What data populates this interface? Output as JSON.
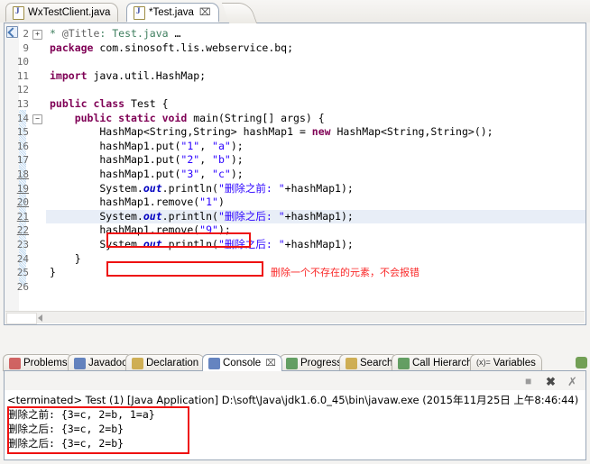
{
  "editor": {
    "tabs": [
      {
        "label": "WxTestClient.java",
        "icon": "java-file-icon",
        "active": false,
        "dirty": false,
        "closeable": false
      },
      {
        "label": "*Test.java",
        "icon": "java-file-icon",
        "active": true,
        "dirty": true,
        "closeable": true,
        "close_glyph": "⌧"
      }
    ],
    "lines": [
      {
        "num": "2",
        "fold": "plus",
        "marker": "javadoc",
        "underline": false,
        "highlight": false,
        "segments": [
          {
            "t": "* ",
            "c": "cmt"
          },
          {
            "t": "@Title",
            "c": "ann"
          },
          {
            "t": ": Test.java ",
            "c": "cmt"
          },
          {
            "t": "…",
            "c": "boxchar"
          }
        ]
      },
      {
        "num": "9",
        "fold": "",
        "marker": "",
        "underline": false,
        "highlight": false,
        "segments": [
          {
            "t": "package ",
            "c": "kw"
          },
          {
            "t": "com.sinosoft.lis.webservice.bq;",
            "c": "pl"
          }
        ]
      },
      {
        "num": "10",
        "fold": "",
        "marker": "",
        "underline": false,
        "highlight": false,
        "segments": [
          {
            "t": "",
            "c": "pl"
          }
        ]
      },
      {
        "num": "11",
        "fold": "",
        "marker": "",
        "underline": false,
        "highlight": false,
        "segments": [
          {
            "t": "import ",
            "c": "kw"
          },
          {
            "t": "java.util.HashMap;",
            "c": "pl"
          }
        ]
      },
      {
        "num": "12",
        "fold": "",
        "marker": "",
        "underline": false,
        "highlight": false,
        "segments": [
          {
            "t": "",
            "c": "pl"
          }
        ]
      },
      {
        "num": "13",
        "fold": "",
        "marker": "",
        "underline": false,
        "highlight": false,
        "segments": [
          {
            "t": "public class ",
            "c": "kw"
          },
          {
            "t": "Test {",
            "c": "pl"
          }
        ]
      },
      {
        "num": "14",
        "fold": "minus",
        "marker": "",
        "underline": false,
        "highlight": false,
        "segments": [
          {
            "t": "    public static void ",
            "c": "kw"
          },
          {
            "t": "main(String[] args) {",
            "c": "pl"
          }
        ]
      },
      {
        "num": "15",
        "fold": "",
        "marker": "",
        "underline": false,
        "highlight": false,
        "segments": [
          {
            "t": "        HashMap<String,String> hashMap1 = ",
            "c": "pl"
          },
          {
            "t": "new ",
            "c": "kw"
          },
          {
            "t": "HashMap<String,String>();",
            "c": "pl"
          }
        ]
      },
      {
        "num": "16",
        "fold": "",
        "marker": "",
        "underline": false,
        "highlight": false,
        "segments": [
          {
            "t": "        hashMap1.put(",
            "c": "pl"
          },
          {
            "t": "\"1\"",
            "c": "str"
          },
          {
            "t": ", ",
            "c": "pl"
          },
          {
            "t": "\"a\"",
            "c": "str"
          },
          {
            "t": ");",
            "c": "pl"
          }
        ]
      },
      {
        "num": "17",
        "fold": "",
        "marker": "",
        "underline": false,
        "highlight": false,
        "segments": [
          {
            "t": "        hashMap1.put(",
            "c": "pl"
          },
          {
            "t": "\"2\"",
            "c": "str"
          },
          {
            "t": ", ",
            "c": "pl"
          },
          {
            "t": "\"b\"",
            "c": "str"
          },
          {
            "t": ");",
            "c": "pl"
          }
        ]
      },
      {
        "num": "18",
        "fold": "",
        "marker": "",
        "underline": true,
        "highlight": false,
        "segments": [
          {
            "t": "        hashMap1.put(",
            "c": "pl"
          },
          {
            "t": "\"3\"",
            "c": "str"
          },
          {
            "t": ", ",
            "c": "pl"
          },
          {
            "t": "\"c\"",
            "c": "str"
          },
          {
            "t": ");",
            "c": "pl"
          }
        ]
      },
      {
        "num": "19",
        "fold": "",
        "marker": "",
        "underline": true,
        "highlight": false,
        "segments": [
          {
            "t": "        System.",
            "c": "pl"
          },
          {
            "t": "out",
            "c": "fld"
          },
          {
            "t": ".println(",
            "c": "pl"
          },
          {
            "t": "\"删除之前: \"",
            "c": "str"
          },
          {
            "t": "+hashMap1);",
            "c": "pl"
          }
        ]
      },
      {
        "num": "20",
        "fold": "",
        "marker": "",
        "underline": true,
        "highlight": false,
        "segments": [
          {
            "t": "        hashMap1.remove(",
            "c": "pl"
          },
          {
            "t": "\"1\"",
            "c": "str"
          },
          {
            "t": ")",
            "c": "pl"
          }
        ]
      },
      {
        "num": "21",
        "fold": "",
        "marker": "",
        "underline": true,
        "highlight": true,
        "segments": [
          {
            "t": "        System.",
            "c": "pl"
          },
          {
            "t": "out",
            "c": "fld"
          },
          {
            "t": ".println(",
            "c": "pl"
          },
          {
            "t": "\"删除之后: \"",
            "c": "str"
          },
          {
            "t": "+hashMap1);",
            "c": "pl"
          }
        ]
      },
      {
        "num": "22",
        "fold": "",
        "marker": "",
        "underline": true,
        "highlight": false,
        "segments": [
          {
            "t": "        hashMap1.remove(",
            "c": "pl"
          },
          {
            "t": "\"9\"",
            "c": "str"
          },
          {
            "t": ");",
            "c": "pl"
          }
        ]
      },
      {
        "num": "23",
        "fold": "",
        "marker": "",
        "underline": false,
        "highlight": false,
        "segments": [
          {
            "t": "        System.",
            "c": "pl"
          },
          {
            "t": "out",
            "c": "fld"
          },
          {
            "t": ".println(",
            "c": "pl"
          },
          {
            "t": "\"删除之后: \"",
            "c": "str"
          },
          {
            "t": "+hashMap1);",
            "c": "pl"
          }
        ]
      },
      {
        "num": "24",
        "fold": "",
        "marker": "",
        "underline": false,
        "highlight": false,
        "segments": [
          {
            "t": "    }",
            "c": "pl"
          }
        ]
      },
      {
        "num": "25",
        "fold": "",
        "marker": "",
        "underline": false,
        "highlight": false,
        "segments": [
          {
            "t": "}",
            "c": "pl"
          }
        ]
      },
      {
        "num": "26",
        "fold": "",
        "marker": "",
        "underline": false,
        "highlight": false,
        "segments": [
          {
            "t": "",
            "c": "pl"
          }
        ]
      }
    ],
    "annotation_note": "删除一个不存在的元素，不会报错",
    "annotation_color": "#fa2a2a"
  },
  "views": {
    "tabs": [
      {
        "label": "Problems",
        "icon": "problems-icon",
        "active": false
      },
      {
        "label": "Javadoc",
        "icon": "javadoc-icon",
        "active": false
      },
      {
        "label": "Declaration",
        "icon": "declaration-icon",
        "active": false
      },
      {
        "label": "Console",
        "icon": "console-icon",
        "active": true,
        "close_glyph": "⌧"
      },
      {
        "label": "Progress",
        "icon": "progress-icon",
        "active": false
      },
      {
        "label": "Search",
        "icon": "search-icon",
        "active": false
      },
      {
        "label": "Call Hierarchy",
        "icon": "call-hierarchy-icon",
        "active": false
      },
      {
        "label": "Variables",
        "icon": "variables-icon",
        "active": false,
        "prefix": "(x)="
      }
    ]
  },
  "console": {
    "toolbar": [
      {
        "name": "terminate-button",
        "glyph": "■"
      },
      {
        "name": "remove-launch-button",
        "glyph": "✖"
      },
      {
        "name": "remove-all-terminated-button",
        "glyph": "✗"
      }
    ],
    "launch_line": "<terminated> Test (1) [Java Application] D:\\soft\\Java\\jdk1.6.0_45\\bin\\javaw.exe (2015年11月25日 上午8:46:44)",
    "output": [
      "删除之前: {3=c, 2=b, 1=a}",
      "删除之后: {3=c, 2=b}",
      "删除之后: {3=c, 2=b}"
    ]
  },
  "highlight_boxes": {
    "color": "#ee1111",
    "boxes": [
      {
        "name": "remove-one-box",
        "label": "hashMap1.remove(\"1\")"
      },
      {
        "name": "remove-nine-box",
        "label": "hashMap1.remove(\"9\");"
      },
      {
        "name": "console-output-box",
        "label": "console output"
      }
    ]
  }
}
